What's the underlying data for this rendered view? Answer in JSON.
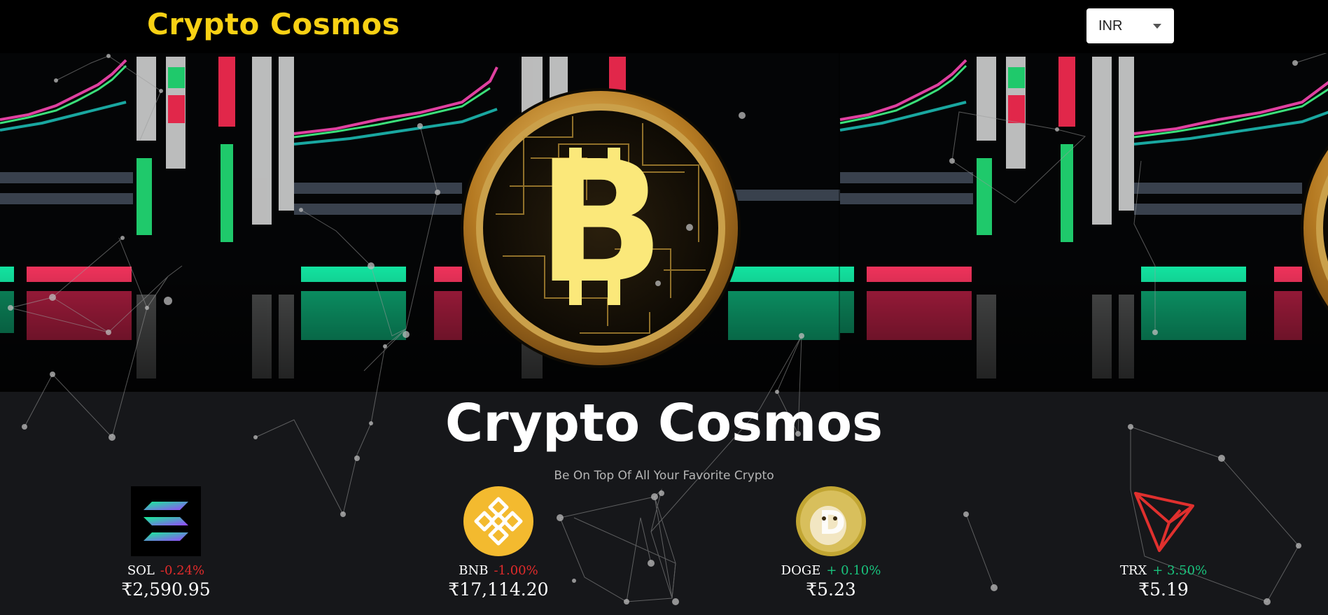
{
  "header": {
    "logo": "Crypto Cosmos",
    "currency": {
      "selected": "INR"
    }
  },
  "banner": {
    "title": "Crypto Cosmos",
    "subtitle": "Be On Top Of All Your Favorite Crypto"
  },
  "carousel": [
    {
      "symbol": "SOL",
      "change": "-0.24%",
      "change_dir": "neg",
      "price": "₹2,590.95",
      "icon": "solana-logo-icon"
    },
    {
      "symbol": "BNB",
      "change": "-1.00%",
      "change_dir": "neg",
      "price": "₹17,114.20",
      "icon": "bnb-logo-icon"
    },
    {
      "symbol": "DOGE",
      "change": "+ 0.10%",
      "change_dir": "pos",
      "price": "₹5.23",
      "icon": "dogecoin-logo-icon"
    },
    {
      "symbol": "TRX",
      "change": "+ 3.50%",
      "change_dir": "pos",
      "price": "₹5.19",
      "icon": "tron-logo-icon"
    }
  ],
  "colors": {
    "brand": "#f8d114",
    "background": "#16171a",
    "negative": "#e12b2b",
    "positive": "#19c37d"
  }
}
